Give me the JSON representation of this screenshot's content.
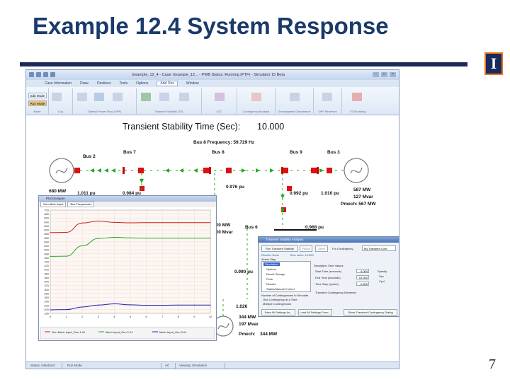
{
  "slide": {
    "title": "Example 12.4 System Response",
    "page_number": "7",
    "logo_letter": "I"
  },
  "app": {
    "window_title": "Example_12_4 - Case: Example_12... - PWB Status: Running (PTF) - Simulator 15 Beta",
    "menu": [
      "Case Information",
      "Draw",
      "Onelines",
      "Tools",
      "Options",
      "Add Ons",
      "Window"
    ],
    "active_menu": "Add Ons",
    "ribbon_groups": [
      "Mode",
      "Log",
      "Optimal Power Flow (OPF)",
      "Transient Stability (TS)",
      "ATC",
      "Contingency Analysis",
      "Geomagnetic Disturbance",
      "OPF Reserves",
      "TS Modeling"
    ],
    "mode_buttons": [
      "Edit Mode",
      "Run Mode"
    ],
    "status_items": [
      "Status: Initialized",
      "Run Mode",
      "AC",
      "Viewing: Simulation"
    ]
  },
  "oneline": {
    "headline_label": "Transient Stability Time (Sec):",
    "headline_value": "10.000",
    "freq_label": "Bus 8 Frequency: 59.729 Hz",
    "buses": [
      "Bus 2",
      "Bus 7",
      "Bus 8",
      "Bus 9",
      "Bus 3",
      "Bus 6"
    ],
    "gen_left_mw": "680 MW",
    "bus2_pu": "1.011 pu",
    "bus7_pu": "0.984 pu",
    "bus8_pu": "0.976 pu",
    "bus9_pu": "0.992 pu",
    "bus3_pu": "1.010 pu",
    "gen_right_mw": "587 MW",
    "gen_right_mvar": "127 Mvar",
    "gen_right_pmech": "Pmech: 567 MW",
    "load_mw": "100 MW",
    "load_mvar": "100 Mvar",
    "bus6_pu": "0.968 pu",
    "bus5_pu": "0.990 pu",
    "bus4_pu": "1.026",
    "gen_bottom_mw": "344 MW",
    "gen_bottom_mvar": "197 Mvar",
    "gen_bottom_pmech_label": "Pmech:",
    "gen_bottom_pmech_value": "344 MW"
  },
  "plot": {
    "window_title": "Plot Designer",
    "tabs": [
      "Gen Mech Input",
      "Bus Frequencies"
    ],
    "legend": [
      "Gen Mech Input_Gen 1 #1",
      "Mech Input_Gen 2 #1",
      "Mech Input_Gen 3 #1"
    ],
    "colors": {
      "red": "#cc2222",
      "green": "#22aa22",
      "blue": "#2222bb"
    }
  },
  "chart_data": {
    "type": "line",
    "title": "",
    "xlabel": "",
    "ylabel": "",
    "xlim": [
      0,
      10
    ],
    "ylim": [
      180,
      700
    ],
    "x_ticks": [
      "0",
      "1",
      "2",
      "3",
      "4",
      "5",
      "6",
      "7",
      "8",
      "9",
      "10"
    ],
    "y_ticks": [
      "700",
      "680",
      "660",
      "640",
      "620",
      "600",
      "580",
      "560",
      "540",
      "520",
      "500",
      "480",
      "460",
      "440",
      "420",
      "400",
      "380",
      "360",
      "340",
      "320",
      "300",
      "280",
      "260",
      "240",
      "220",
      "200",
      "180"
    ],
    "series": [
      {
        "color": "#cc2222",
        "x": [
          0,
          1,
          2,
          3,
          4,
          5,
          6,
          7,
          8,
          9,
          10
        ],
        "values": [
          587,
          588,
          635,
          645,
          638,
          636,
          637,
          637,
          637,
          637,
          637
        ]
      },
      {
        "color": "#22aa22",
        "x": [
          0,
          1,
          2,
          3,
          4,
          5,
          6,
          7,
          8,
          9,
          10
        ],
        "values": [
          467,
          468,
          520,
          557,
          563,
          560,
          559,
          559,
          559,
          559,
          559
        ]
      },
      {
        "color": "#2222bb",
        "x": [
          0,
          1,
          2,
          3,
          4,
          5,
          6,
          7,
          8,
          9,
          10
        ],
        "values": [
          198,
          199,
          212,
          222,
          228,
          223,
          221,
          221,
          222,
          222,
          222
        ]
      }
    ]
  },
  "dialog": {
    "title": "Transient Stability Analysis",
    "run_button": "Run Transient Stability",
    "pause_button": "Pause",
    "abort_button": "Abort",
    "for_contingency_label": "For Contingency",
    "contingency_value": "My Transient Cont",
    "results_status": "Results: None",
    "results_time": "Time  solve: 10.000",
    "select_step_label": "Select Step",
    "steps": [
      "Simulation",
      "Options",
      "Result Storage",
      "Plots",
      "Results",
      "States/Manual Control"
    ],
    "sim_time_values_label": "Simulation Time Values",
    "start_time_label": "Start Time (seconds)",
    "start_time_value": "0.000",
    "end_time_label": "End Time (seconds)",
    "end_time_value": "10.000",
    "time_step_label": "Time Step (cycles)",
    "time_step_value": "0.500",
    "specify_label": "Specify",
    "seconds_label": "Sec",
    "cycles_label": "Cycl",
    "contingency_elements_label": "Transient Contingency Elements",
    "study_label": "Number of Contingencies to Simulate",
    "radio_one": "One Contingency at a Time",
    "radio_multiple": "Multiple Contingencies",
    "save_button": "Save All Settings As...",
    "load_button": "Load All Settings From...",
    "show_button": "Show Transient Contingency Dialog"
  }
}
